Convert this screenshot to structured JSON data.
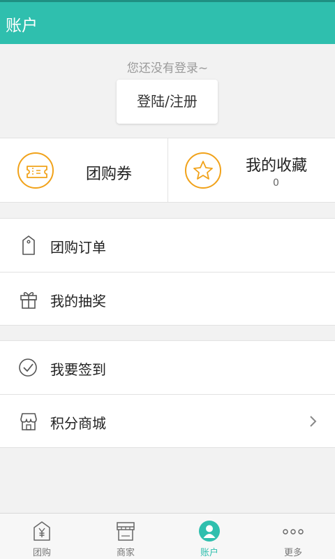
{
  "header": {
    "title": "账户"
  },
  "login": {
    "hint": "您还没有登录~",
    "button_label": "登陆/注册"
  },
  "quick": {
    "coupon_label": "团购券",
    "favorites_label": "我的收藏",
    "favorites_count": "0"
  },
  "menu_group1": [
    {
      "label": "团购订单",
      "icon": "tag-icon"
    },
    {
      "label": "我的抽奖",
      "icon": "gift-icon"
    }
  ],
  "menu_group2": [
    {
      "label": "我要签到",
      "icon": "check-circle-icon"
    },
    {
      "label": "积分商城",
      "icon": "shop-icon"
    }
  ],
  "tabs": [
    {
      "label": "团购",
      "icon": "yuan-tag-icon"
    },
    {
      "label": "商家",
      "icon": "store-icon"
    },
    {
      "label": "账户",
      "icon": "user-icon",
      "active": true
    },
    {
      "label": "更多",
      "icon": "more-dots-icon"
    }
  ],
  "colors": {
    "accent": "#2fbfae",
    "orange": "#f1a21a",
    "background": "#f2f2f2"
  }
}
